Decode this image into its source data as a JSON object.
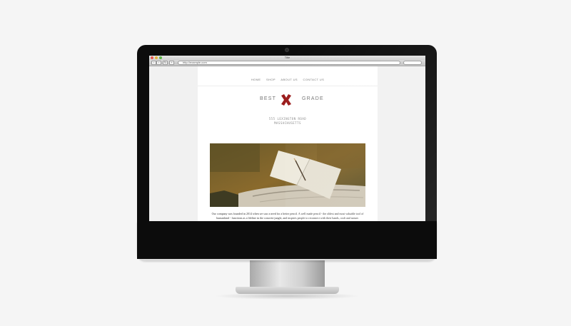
{
  "browser": {
    "window_title": "Title",
    "url": "http://example.com"
  },
  "site": {
    "nav": [
      "HOME",
      "SHOP",
      "ABOUT US",
      "CONTACT US"
    ],
    "logo_left": "BEST",
    "logo_right": "GRADE",
    "logo_color": "#9b1c1c",
    "address_line1": "555 LEXINGTON ROAD",
    "address_line2": "MASSACHUSETTS",
    "paragraph": "Our company was founded in 2014 when we saw a need for a better pencil. A well made pencil - the oldest and most valuable tool of humankind - functions as a lifeline in the concrete jungle, and inspires people to reconnect with their hands, craft and nature."
  },
  "colors": {
    "accent": "#9b1c1c",
    "bezel": "#0c0c0c",
    "background": "#f5f5f5"
  }
}
